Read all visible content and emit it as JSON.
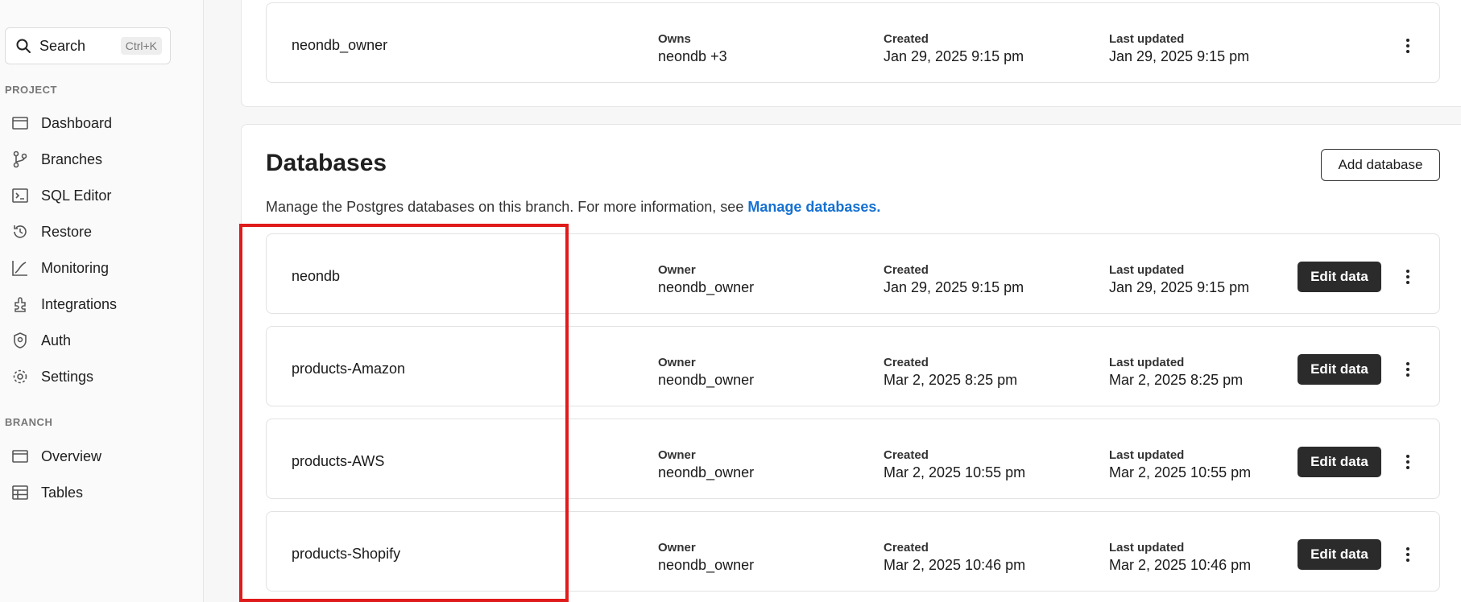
{
  "sidebar": {
    "search": {
      "label": "Search",
      "shortcut": "Ctrl+K"
    },
    "project_title": "PROJECT",
    "project_items": [
      {
        "label": "Dashboard",
        "icon": "dashboard-icon"
      },
      {
        "label": "Branches",
        "icon": "branches-icon"
      },
      {
        "label": "SQL Editor",
        "icon": "sql-editor-icon"
      },
      {
        "label": "Restore",
        "icon": "restore-icon"
      },
      {
        "label": "Monitoring",
        "icon": "monitoring-icon"
      },
      {
        "label": "Integrations",
        "icon": "integrations-icon"
      },
      {
        "label": "Auth",
        "icon": "auth-icon"
      },
      {
        "label": "Settings",
        "icon": "settings-icon"
      }
    ],
    "branch_title": "BRANCH",
    "branch_items": [
      {
        "label": "Overview",
        "icon": "overview-icon"
      },
      {
        "label": "Tables",
        "icon": "tables-icon"
      }
    ]
  },
  "roles": {
    "rows": [
      {
        "name": "neondb_owner",
        "owns_label": "Owns",
        "owns_value": "neondb +3",
        "created_label": "Created",
        "created_value": "Jan 29, 2025 9:15 pm",
        "updated_label": "Last updated",
        "updated_value": "Jan 29, 2025 9:15 pm"
      }
    ]
  },
  "databases": {
    "title": "Databases",
    "add_button": "Add database",
    "description": "Manage the Postgres databases on this branch. For more information, see ",
    "description_link": "Manage databases.",
    "edit_label": "Edit data",
    "rows": [
      {
        "name": "neondb",
        "owner_label": "Owner",
        "owner_value": "neondb_owner",
        "created_label": "Created",
        "created_value": "Jan 29, 2025 9:15 pm",
        "updated_label": "Last updated",
        "updated_value": "Jan 29, 2025 9:15 pm"
      },
      {
        "name": "products-Amazon",
        "owner_label": "Owner",
        "owner_value": "neondb_owner",
        "created_label": "Created",
        "created_value": "Mar 2, 2025 8:25 pm",
        "updated_label": "Last updated",
        "updated_value": "Mar 2, 2025 8:25 pm"
      },
      {
        "name": "products-AWS",
        "owner_label": "Owner",
        "owner_value": "neondb_owner",
        "created_label": "Created",
        "created_value": "Mar 2, 2025 10:55 pm",
        "updated_label": "Last updated",
        "updated_value": "Mar 2, 2025 10:55 pm"
      },
      {
        "name": "products-Shopify",
        "owner_label": "Owner",
        "owner_value": "neondb_owner",
        "created_label": "Created",
        "created_value": "Mar 2, 2025 10:46 pm",
        "updated_label": "Last updated",
        "updated_value": "Mar 2, 2025 10:46 pm"
      }
    ]
  },
  "colors": {
    "accent_link": "#1570d1",
    "highlight_box": "#e01b1b",
    "button_dark": "#2b2b2b"
  }
}
